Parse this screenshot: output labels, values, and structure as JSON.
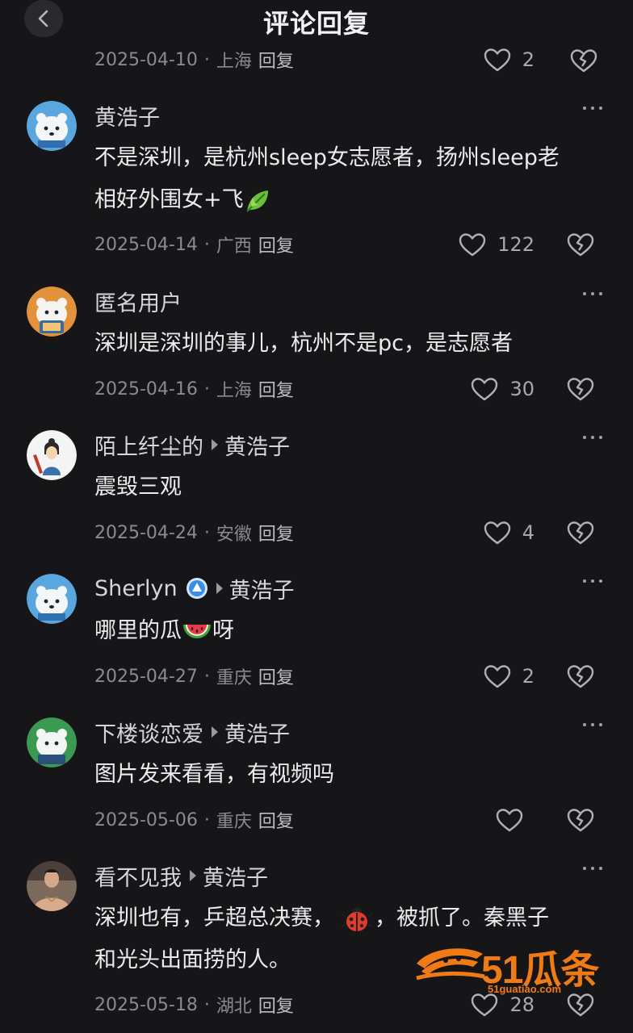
{
  "header": {
    "title": "评论回复"
  },
  "top_meta": {
    "date": "2025-04-10",
    "location": "上海",
    "reply": "回复",
    "likes": "2"
  },
  "sep": "·",
  "comments": [
    {
      "name": "黄浩子",
      "reply_to": "",
      "text_lines": [
        "不是深圳，是杭州sleep女志愿者，扬州sleep老",
        "相好外围女+飞"
      ],
      "date": "2025-04-14",
      "location": "广西",
      "reply": "回复",
      "likes": "122",
      "avatar": "polar-bear-blue"
    },
    {
      "name": "匿名用户",
      "reply_to": "",
      "text_lines": [
        "深圳是深圳的事儿，杭州不是pc，是志愿者"
      ],
      "date": "2025-04-16",
      "location": "上海",
      "reply": "回复",
      "likes": "30",
      "avatar": "polar-bear-orange"
    },
    {
      "name": "陌上纤尘的",
      "reply_to": "黄浩子",
      "text_lines": [
        "震毁三观"
      ],
      "date": "2025-04-24",
      "location": "安徽",
      "reply": "回复",
      "likes": "4",
      "avatar": "cartoon-person"
    },
    {
      "name": "Sherlyn",
      "reply_to": "黄浩子",
      "text_lines": [
        "哪里的瓜",
        "呀"
      ],
      "date": "2025-04-27",
      "location": "重庆",
      "reply": "回复",
      "likes": "2",
      "avatar": "polar-bear-blue"
    },
    {
      "name": "下楼谈恋爱",
      "reply_to": "黄浩子",
      "text_lines": [
        "图片发来看看，有视频吗"
      ],
      "date": "2025-05-06",
      "location": "重庆",
      "reply": "回复",
      "likes": "",
      "avatar": "polar-bear-green"
    },
    {
      "name": "看不见我",
      "reply_to": "黄浩子",
      "text_lines": [
        "深圳也有，乒超总决赛，",
        "，被抓了。秦黑子",
        "和光头出面捞的人。"
      ],
      "date": "2025-05-18",
      "location": "湖北",
      "reply": "回复",
      "likes": "28",
      "avatar": "photo-man"
    }
  ],
  "watermark": {
    "brand": "51瓜条",
    "url": "51guatiao.com"
  },
  "colors": {
    "background": "#161618",
    "meta_gray": "#8a8a90",
    "text": "#ececee",
    "watermark": "#f07a16"
  },
  "icons": [
    "back-icon",
    "heart-icon",
    "broken-heart-icon",
    "more-icon",
    "leaf-emoji",
    "watermelon-emoji",
    "ladybug-emoji",
    "verified-badge-icon"
  ]
}
